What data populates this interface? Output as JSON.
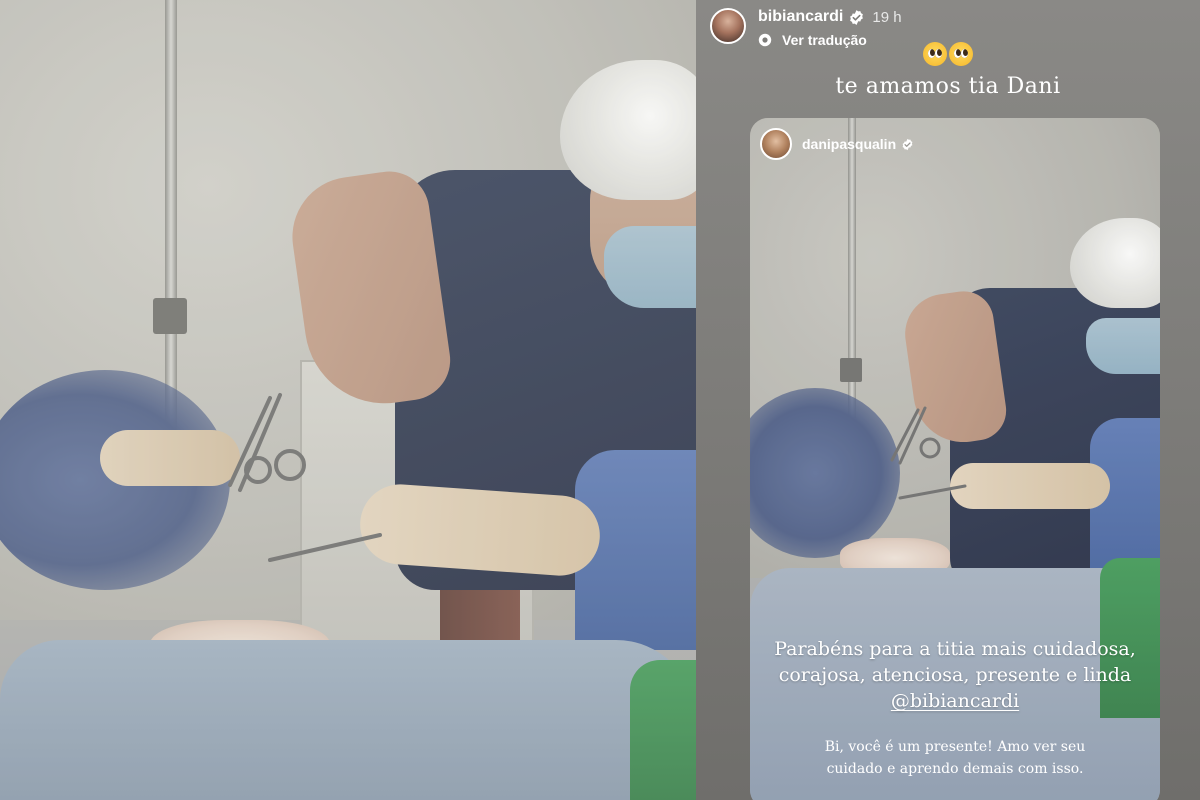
{
  "story": {
    "username": "bibiancardi",
    "time": "19 h",
    "translate_label": "Ver tradução",
    "emojis": [
      "pleading-face",
      "pleading-face"
    ],
    "caption": "te amamos tia Dani"
  },
  "shared_post": {
    "username": "danipasqualin",
    "tribute_line1": "Parabéns para a titia mais cuidadosa,",
    "tribute_line2": "corajosa, atenciosa, presente e linda",
    "tribute_mention": "@bibiancardi",
    "note_line1": "Bi, você é um presente! Amo ver seu",
    "note_line2": "cuidado e aprendo demais com isso."
  },
  "colors": {
    "verified_badge": "#ffffff",
    "text": "#ffffff"
  }
}
